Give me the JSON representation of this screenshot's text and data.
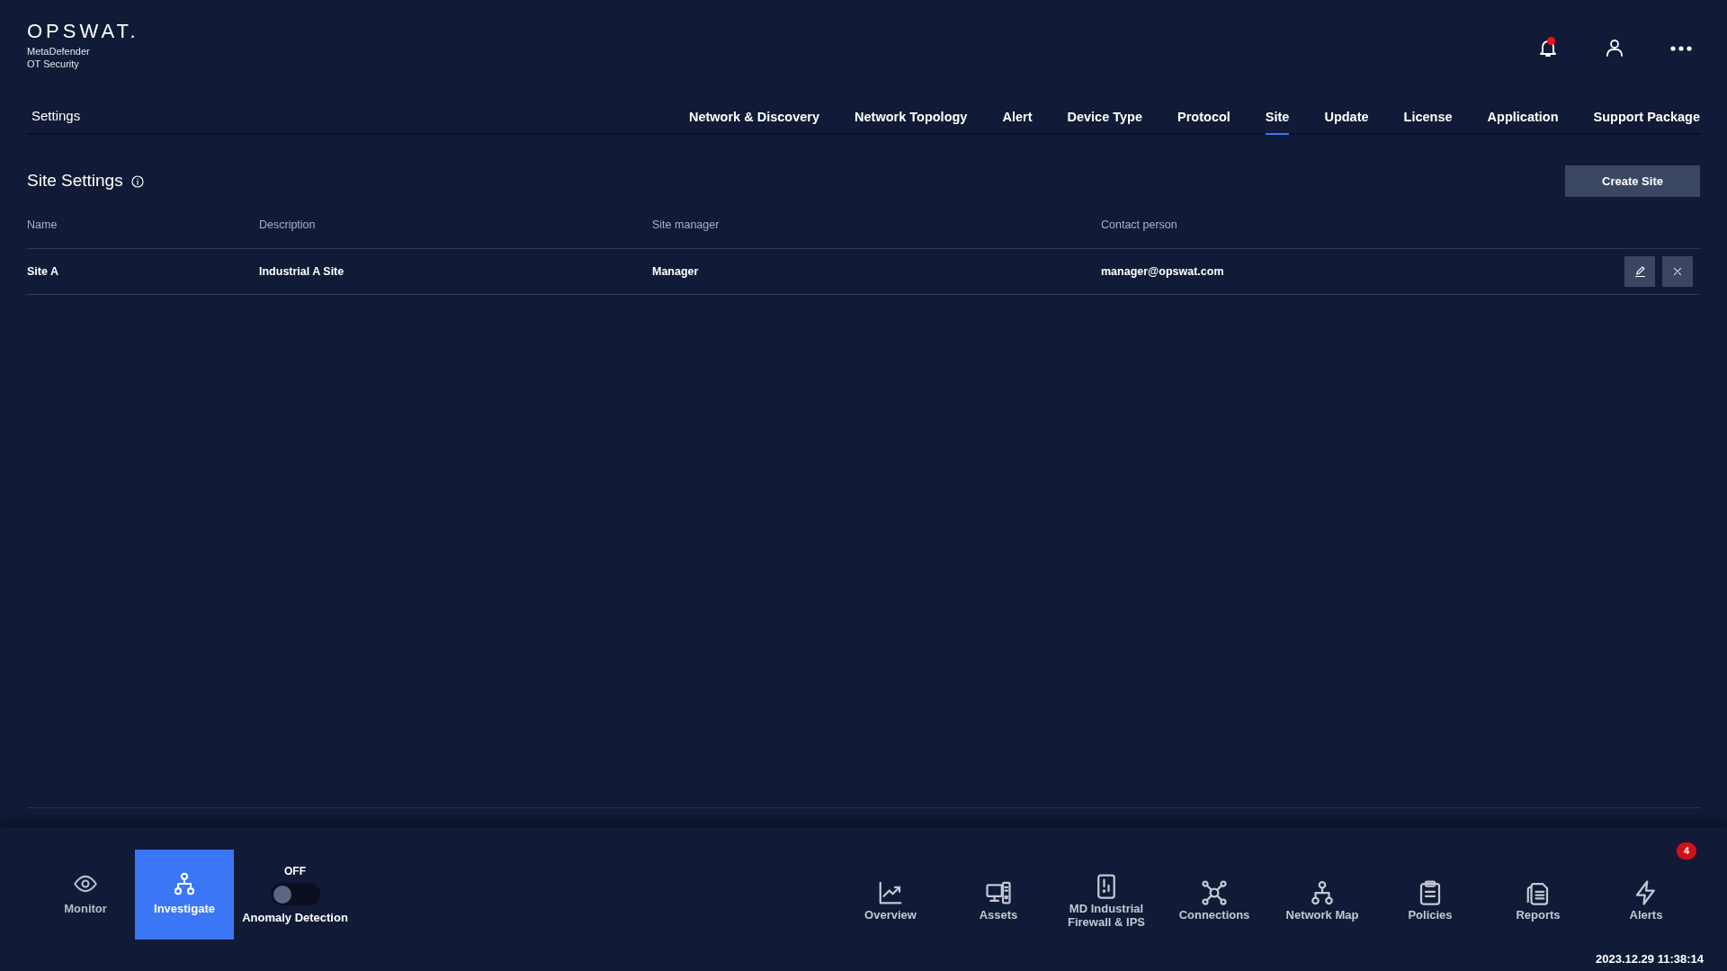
{
  "brand": {
    "logo": "OPSWAT.",
    "product": "MetaDefender",
    "edition": "OT Security"
  },
  "header": {
    "unread_notifications": true
  },
  "section_title": "Settings",
  "tabs": [
    {
      "label": "Network & Discovery",
      "selected": false
    },
    {
      "label": "Network Topology",
      "selected": false
    },
    {
      "label": "Alert",
      "selected": false
    },
    {
      "label": "Device Type",
      "selected": false
    },
    {
      "label": "Protocol",
      "selected": false
    },
    {
      "label": "Site",
      "selected": true
    },
    {
      "label": "Update",
      "selected": false
    },
    {
      "label": "License",
      "selected": false
    },
    {
      "label": "Application",
      "selected": false
    },
    {
      "label": "Support Package",
      "selected": false
    }
  ],
  "page": {
    "title": "Site Settings",
    "create_button": "Create Site"
  },
  "table": {
    "columns": [
      "Name",
      "Description",
      "Site manager",
      "Contact person"
    ],
    "rows": [
      {
        "cells": [
          "Site A",
          "Industrial A Site",
          "Manager",
          "manager@opswat.com"
        ]
      }
    ]
  },
  "modes": [
    {
      "label": "Monitor",
      "selected": false
    },
    {
      "label": "Investigate",
      "selected": true
    }
  ],
  "anomaly": {
    "state_label": "OFF",
    "on": false,
    "label": "Anomaly Detection"
  },
  "dock": [
    {
      "label": "Overview"
    },
    {
      "label": "Assets"
    },
    {
      "label": "MD Industrial Firewall & IPS"
    },
    {
      "label": "Connections"
    },
    {
      "label": "Network Map"
    },
    {
      "label": "Policies"
    },
    {
      "label": "Reports"
    },
    {
      "label": "Alerts",
      "badge": "4"
    }
  ],
  "timestamp": "2023.12.29 11:38:14"
}
